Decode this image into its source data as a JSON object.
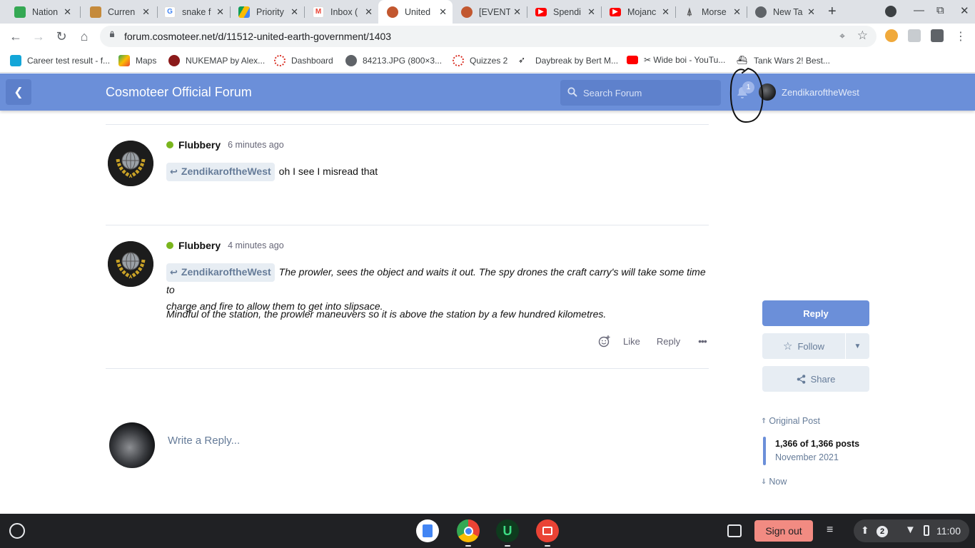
{
  "browser": {
    "tabs": [
      {
        "title": "Nation",
        "icon": "google-earth-icon",
        "color": "#34a853"
      },
      {
        "title": "Curren",
        "icon": "currency-icon",
        "color": "#c58a3b"
      },
      {
        "title": "snake f",
        "icon": "google-icon",
        "color": "#4285f4"
      },
      {
        "title": "Priority",
        "icon": "google-drive-icon",
        "color": "#fbbc04"
      },
      {
        "title": "Inbox (",
        "icon": "gmail-icon",
        "color": "#ea4335"
      },
      {
        "title": "United",
        "icon": "cosmoteer-icon",
        "color": "#c2572f"
      },
      {
        "title": "[EVENT",
        "icon": "cosmoteer-icon",
        "color": "#c2572f"
      },
      {
        "title": "Spendi",
        "icon": "youtube-icon",
        "color": "#ff0000"
      },
      {
        "title": "Mojanc",
        "icon": "youtube-icon",
        "color": "#ff0000"
      },
      {
        "title": "Morse",
        "icon": "morse-icon",
        "color": "#555555"
      },
      {
        "title": "New Ta",
        "icon": "chrome-icon",
        "color": "#5f6368"
      }
    ],
    "active_tab": 5,
    "url": "forum.cosmoteer.net/d/11512-united-earth-government/1403",
    "bookmarks": [
      {
        "label": "Career test result - f...",
        "color": "#13a6d8"
      },
      {
        "label": "Maps",
        "color": "#34a853"
      },
      {
        "label": "NUKEMAP by Alex...",
        "color": "#8b1a1a"
      },
      {
        "label": "Dashboard",
        "color": "#d93025"
      },
      {
        "label": "84213.JPG (800×3...",
        "color": "#5f6368"
      },
      {
        "label": "Quizzes 2",
        "color": "#d93025"
      },
      {
        "label": "Daybreak by Bert M...",
        "color": "#202124"
      },
      {
        "label": "✂ Wide boi - YouTu...",
        "color": "#ff0000"
      },
      {
        "label": "Tank Wars 2! Best...",
        "color": "#202124"
      }
    ]
  },
  "forum": {
    "title": "Cosmoteer Official Forum",
    "search_placeholder": "Search Forum",
    "notification_count": "1",
    "username": "ZendikaroftheWest",
    "accent": "#6b8fd9"
  },
  "posts": [
    {
      "author": "Flubbery",
      "time": "6 minutes ago",
      "mention": "ZendikaroftheWest",
      "text": "oh I see I misread that"
    },
    {
      "author": "Flubbery",
      "time": "4 minutes ago",
      "mention": "ZendikaroftheWest",
      "text_line1": "The prowler, sees the object and waits it out. The spy drones the craft carry's will take some time to",
      "text_line2": "charge and fire to allow them to get into slipsace.",
      "paragraph2": "Mindful of the station, the prowler maneuvers so it is above the station by a few hundred kilometres.",
      "actions": {
        "like": "Like",
        "reply": "Reply",
        "more": "•••"
      }
    }
  ],
  "composer": {
    "placeholder": "Write a Reply..."
  },
  "sidebar": {
    "reply": "Reply",
    "follow": "Follow",
    "share": "Share",
    "original_post": "Original Post",
    "position": "1,366 of 1,366 posts",
    "date": "November 2021",
    "now": "Now"
  },
  "shelf": {
    "sign_out": "Sign out",
    "notification_count": "2",
    "time": "11:00"
  }
}
